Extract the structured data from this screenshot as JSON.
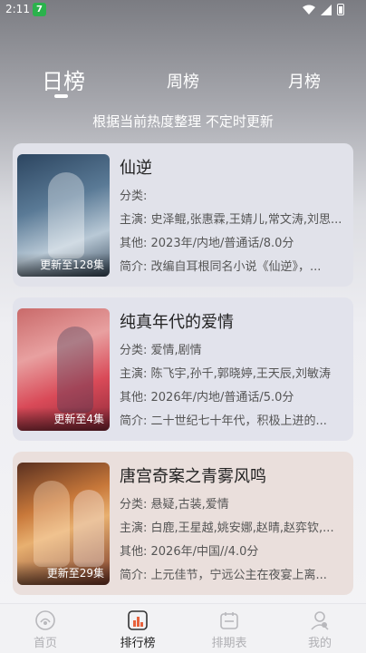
{
  "status_bar": {
    "time": "2:11",
    "app_badge": "7"
  },
  "tabs": [
    {
      "label": "日榜",
      "active": true
    },
    {
      "label": "周榜",
      "active": false
    },
    {
      "label": "月榜",
      "active": false
    }
  ],
  "subtitle": "根据当前热度整理 不定时更新",
  "cards": [
    {
      "title": "仙逆",
      "poster_status": "更新至128集",
      "genre": "分类:",
      "cast": "主演: 史泽鲲,张惠霖,王婧儿,常文涛,刘思...",
      "other": "其他: 2023年/内地/普通话/8.0分",
      "intro": "简介: 改编自耳根同名小说《仙逆》，..."
    },
    {
      "title": "纯真年代的爱情",
      "poster_status": "更新至4集",
      "genre": "分类: 爱情,剧情",
      "cast": "主演: 陈飞宇,孙千,郭晓婷,王天辰,刘敏涛",
      "other": "其他: 2026年/内地/普通话/5.0分",
      "intro": "简介: 二十世纪七十年代，积极上进的..."
    },
    {
      "title": "唐宫奇案之青雾风鸣",
      "poster_status": "更新至29集",
      "genre": "分类: 悬疑,古装,爱情",
      "cast": "主演: 白鹿,王星越,姚安娜,赵晴,赵弈钦,...",
      "other": "其他: 2026年/中国//4.0分",
      "intro": "简介: 上元佳节，宁远公主在夜宴上离..."
    }
  ],
  "bottom_nav": [
    {
      "label": "首页",
      "icon": "home-icon",
      "active": false
    },
    {
      "label": "排行榜",
      "icon": "ranking-icon",
      "active": true
    },
    {
      "label": "排期表",
      "icon": "calendar-icon",
      "active": false
    },
    {
      "label": "我的",
      "icon": "profile-icon",
      "active": false
    }
  ]
}
